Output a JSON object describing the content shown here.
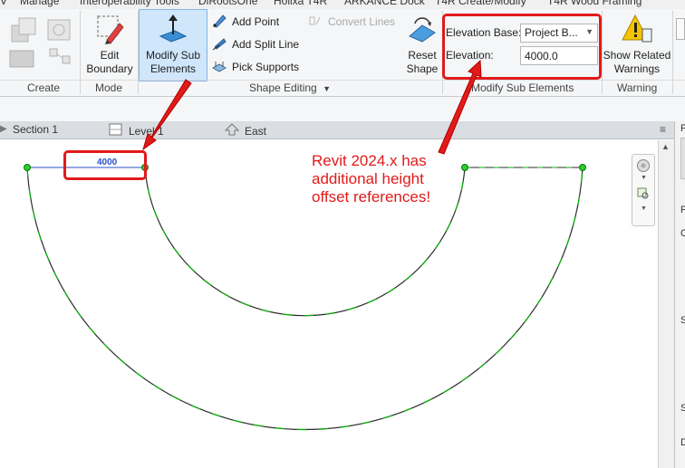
{
  "ribbon_tabs": [
    "Manage",
    "Interoperability Tools",
    "DiRootsOne",
    "Holixa T4R",
    "ARKANCE Dock",
    "T4R Create/Modify",
    "T4R Wood Framing"
  ],
  "groups": {
    "create": "Create",
    "mode": "Mode",
    "shape_editing": "Shape Editing",
    "modify_sub_elements": "Modify Sub Elements",
    "warning": "Warning"
  },
  "buttons": {
    "edit_boundary": "Edit Boundary",
    "modify_sub_elements": "Modify Sub Elements",
    "add_point": "Add Point",
    "add_split_line": "Add Split Line",
    "pick_supports": "Pick Supports",
    "convert_lines": "Convert Lines",
    "reset_shape": "Reset Shape",
    "show_related_warnings": "Show Related Warnings"
  },
  "fields": {
    "elevation_base_label": "Elevation Base:",
    "elevation_base_value": "Project B...",
    "elevation_label": "Elevation:",
    "elevation_value": "4000.0"
  },
  "view_tabs": [
    "Section 1",
    "Level 1",
    "East"
  ],
  "dimension_label": "4000",
  "annotation_text": "Revit 2024.x has\nadditional height\noffset references!",
  "properties_letters": [
    "P",
    "F",
    "C",
    "S",
    "S",
    "D"
  ],
  "colors": {
    "highlight": "#e11a1a",
    "dimension": "#2a50c8",
    "edge_green": "#00b400",
    "active_button": "#cfe6fb"
  },
  "icons": {
    "create": "cube-icon",
    "edit_boundary": "pencil-boundary-icon",
    "modify_sub_elements": "arrow-up-plane-icon",
    "add_point": "pencil-point-icon",
    "add_split_line": "pencil-line-icon",
    "pick_supports": "supports-icon",
    "reset_shape": "reset-shape-icon",
    "show_related_warnings": "warning-icon"
  }
}
